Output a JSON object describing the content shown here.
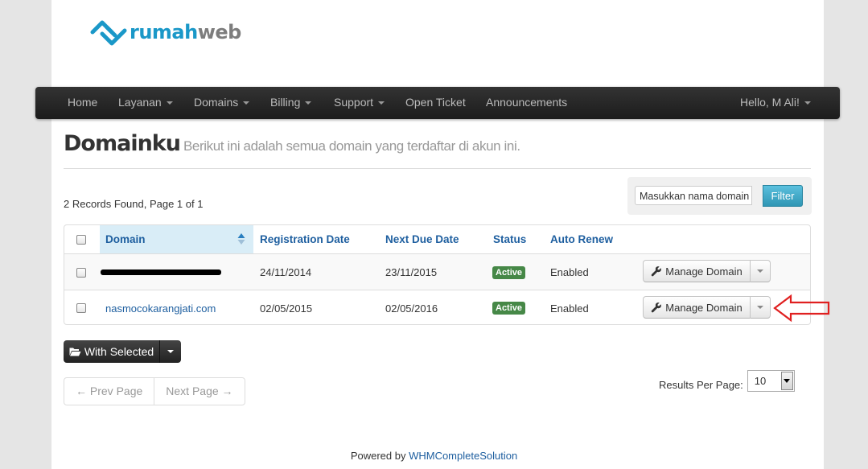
{
  "brand": {
    "logo_text_a": "rumah",
    "logo_text_b": "web"
  },
  "nav": {
    "home": "Home",
    "layanan": "Layanan",
    "domains": "Domains",
    "billing": "Billing",
    "support": "Support",
    "open_ticket": "Open Ticket",
    "announcements": "Announcements",
    "user": "Hello, M Ali!"
  },
  "page": {
    "title": "Domainku",
    "subtitle": "Berikut ini adalah semua domain yang terdaftar di akun ini."
  },
  "records_text": "2 Records Found, Page 1 of 1",
  "filter": {
    "placeholder": "Masukkan nama domain ...",
    "button": "Filter"
  },
  "table": {
    "headers": {
      "domain": "Domain",
      "registration": "Registration Date",
      "next_due": "Next Due Date",
      "status": "Status",
      "auto_renew": "Auto Renew"
    },
    "rows": [
      {
        "domain": "",
        "domain_redacted": true,
        "registration": "24/11/2014",
        "next_due": "23/11/2015",
        "status": "Active",
        "auto_renew": "Enabled",
        "action": "Manage Domain"
      },
      {
        "domain": "nasmocokarangjati.com",
        "domain_redacted": false,
        "registration": "02/05/2015",
        "next_due": "02/05/2016",
        "status": "Active",
        "auto_renew": "Enabled",
        "action": "Manage Domain"
      }
    ]
  },
  "with_selected": "With Selected",
  "pagination": {
    "prev": "← Prev Page",
    "next": "Next Page →"
  },
  "results_per_page": {
    "label": "Results Per Page:",
    "value": "10"
  },
  "footer": {
    "prefix": "Powered by ",
    "link": "WHMCompleteSolution"
  },
  "colors": {
    "accent": "#1a98c8",
    "link": "#1d5e9f",
    "active_badge": "#468847",
    "navbar": "#222222",
    "annotation_arrow": "#e02020"
  }
}
